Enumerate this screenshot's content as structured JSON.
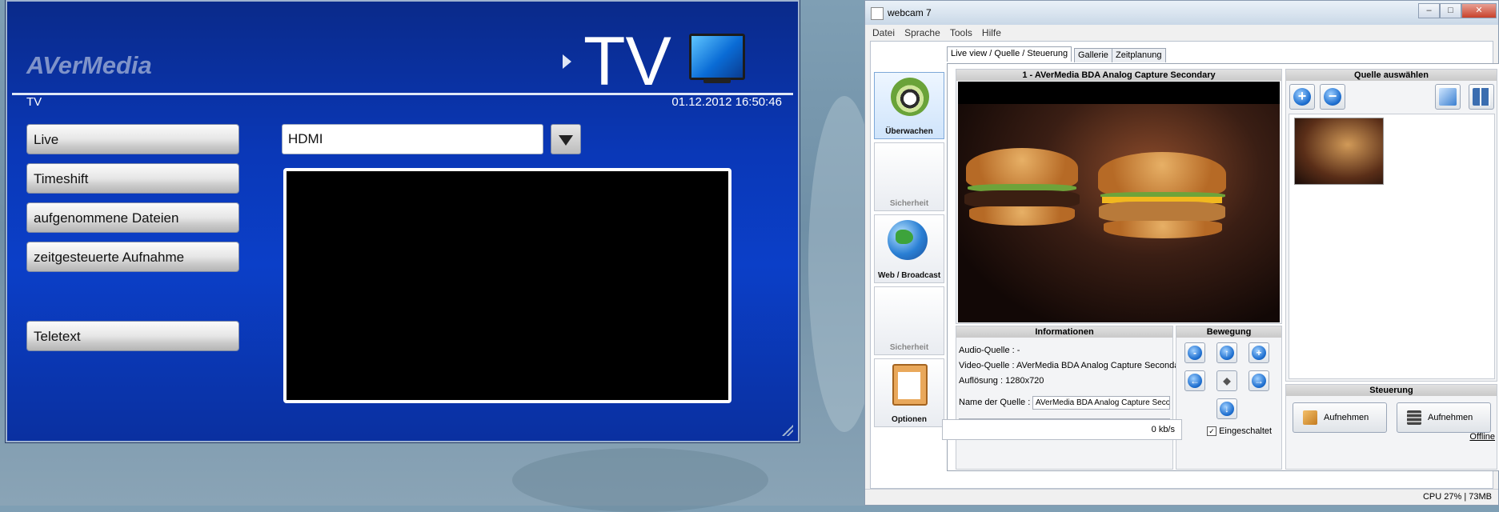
{
  "avermedia": {
    "brand": "AVerMedia",
    "mode_title": "TV",
    "header_label": "TV",
    "datetime": "01.12.2012 16:50:46",
    "menu": [
      "Live",
      "Timeshift",
      "aufgenommene Dateien",
      "zeitgesteuerte Aufnahme",
      "Teletext"
    ],
    "source_value": "HDMI"
  },
  "webcam": {
    "title": "webcam 7",
    "window_buttons": {
      "minimize": "–",
      "maximize": "□",
      "close": "✕"
    },
    "menu": [
      "Datei",
      "Sprache",
      "Tools",
      "Hilfe"
    ],
    "nav": [
      "Überwachen",
      "Sicherheit",
      "Web / Broadcast",
      "Sicherheit",
      "Optionen"
    ],
    "tabs": [
      "Live view / Quelle / Steuerung",
      "Gallerie",
      "Zeitplanung"
    ],
    "video_title": "1 - AVerMedia BDA Analog Capture Secondary",
    "info": {
      "title": "Informationen",
      "audio": "Audio-Quelle : -",
      "video": "Video-Quelle : AVerMedia BDA Analog Capture Secondar",
      "resolution": "Auflösung : 1280x720",
      "name_label": "Name der Quelle :",
      "name_value": "AVerMedia BDA Analog Capture Secondary",
      "extra_value": "-"
    },
    "movement": {
      "title": "Bewegung",
      "enabled_label": "Eingeschaltet",
      "enabled": true
    },
    "source_select": {
      "title": "Quelle auswählen"
    },
    "control": {
      "title": "Steuerung",
      "record1": "Aufnehmen",
      "record2": "Aufnehmen"
    },
    "rate": "0 kb/s",
    "offline": "Offline",
    "status": "CPU 27% | 73MB"
  },
  "colors": {
    "avermedia_blue": "#0b3fc8",
    "accent_blue": "#1e6fd0"
  }
}
